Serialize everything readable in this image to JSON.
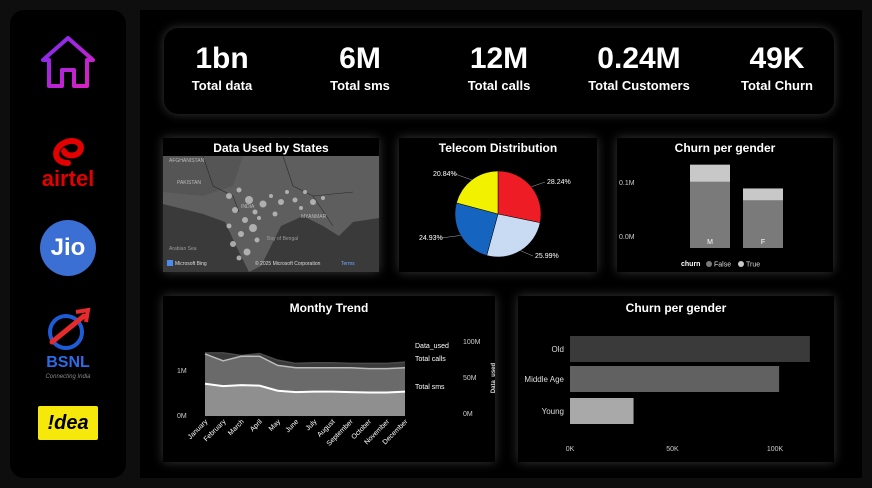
{
  "sidebar": {
    "brands": [
      {
        "name": "home"
      },
      {
        "name": "airtel",
        "label": "airtel"
      },
      {
        "name": "jio",
        "label": "Jio"
      },
      {
        "name": "bsnl",
        "label": "BSNL",
        "tagline": "Connecting India"
      },
      {
        "name": "idea",
        "label": "!dea"
      }
    ]
  },
  "kpis": [
    {
      "value": "1bn",
      "label": "Total data"
    },
    {
      "value": "6M",
      "label": "Total sms"
    },
    {
      "value": "12M",
      "label": "Total calls"
    },
    {
      "value": "0.24M",
      "label": "Total Customers"
    },
    {
      "value": "49K",
      "label": "Total Churn"
    }
  ],
  "map": {
    "title": "Data Used by States",
    "labels": [
      "AFGHANISTAN",
      "PAKISTAN",
      "INDIA",
      "MYANMAR",
      "Arabian Sea",
      "Bay of Bengal"
    ],
    "attribution": "© 2025 Microsoft Corporation",
    "terms": "Terms",
    "bing": "Microsoft Bing"
  },
  "chart_data": [
    {
      "type": "pie",
      "title": "Telecom Distribution",
      "slices": [
        {
          "value": 28.24,
          "label": "28.24%",
          "color": "#ee1c25"
        },
        {
          "value": 25.99,
          "label": "25.99%",
          "color": "#c8dbf2"
        },
        {
          "value": 24.93,
          "label": "24.93%",
          "color": "#1565c0"
        },
        {
          "value": 20.84,
          "label": "20.84%",
          "color": "#f2f200"
        }
      ]
    },
    {
      "type": "bar",
      "stacked": true,
      "title": "Churn per gender",
      "categories": [
        "M",
        "F"
      ],
      "series": [
        {
          "name": "False",
          "values": [
            0.1,
            0.072
          ],
          "color": "#7a7a7a"
        },
        {
          "name": "True",
          "values": [
            0.026,
            0.018
          ],
          "color": "#c8c8c8"
        }
      ],
      "yticks": [
        "0.1M",
        "0.0M"
      ],
      "ylim": [
        0,
        0.13
      ],
      "legend_title": "churn",
      "legend_position": "bottom"
    },
    {
      "type": "area",
      "title": "Monthy Trend",
      "categories": [
        "January",
        "February",
        "March",
        "April",
        "May",
        "June",
        "July",
        "August",
        "September",
        "October",
        "November",
        "December"
      ],
      "series": [
        {
          "name": "Data_used",
          "values": [
            96,
            96,
            92,
            95,
            85,
            80,
            81,
            81,
            80,
            80,
            80,
            82
          ],
          "axis": "right",
          "color": "#3a3a3a"
        },
        {
          "name": "Total calls",
          "values": [
            1.35,
            1.2,
            1.3,
            1.3,
            1.1,
            1.05,
            1.05,
            1.05,
            1.05,
            1.03,
            1.03,
            1.05
          ],
          "axis": "left",
          "color": "#6a6a6a"
        },
        {
          "name": "Total sms",
          "values": [
            0.7,
            0.65,
            0.67,
            0.66,
            0.55,
            0.52,
            0.53,
            0.53,
            0.52,
            0.51,
            0.51,
            0.53
          ],
          "axis": "left",
          "color": "#8f8f8f"
        }
      ],
      "yticks_left": [
        "1M",
        "0M"
      ],
      "yticks_right": [
        "100M",
        "50M",
        "0M"
      ],
      "ylabel_right": "Data_used",
      "ylim_left": [
        0,
        2
      ],
      "ylim_right": [
        0,
        140
      ]
    },
    {
      "type": "bar",
      "orientation": "horizontal",
      "title": "Churn per gender",
      "categories": [
        "Old",
        "Middle Age",
        "Young"
      ],
      "values": [
        117000,
        102000,
        31000
      ],
      "colors": [
        "#3a3a3a",
        "#616161",
        "#a9a9a9"
      ],
      "xticks": [
        "0K",
        "50K",
        "100K"
      ],
      "xlim": [
        0,
        120000
      ]
    }
  ]
}
